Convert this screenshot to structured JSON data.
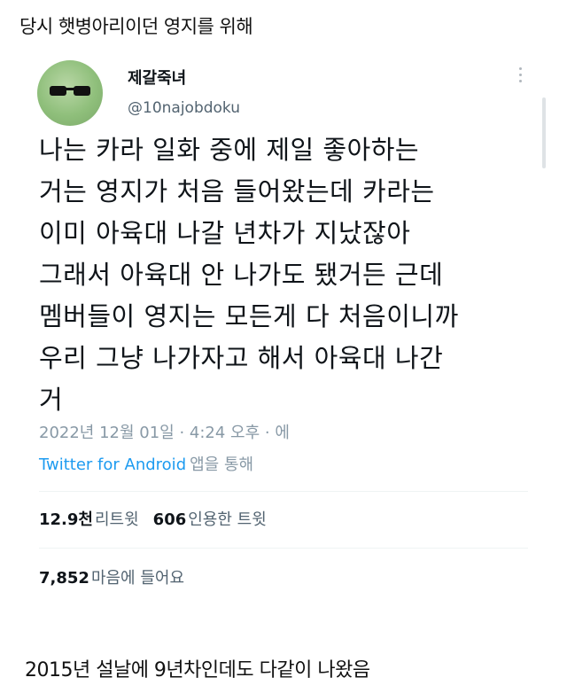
{
  "caption_top": "당시 햇병아리이던 영지를 위해",
  "tweet": {
    "author_name": "제갈죽녀",
    "handle": "@10najobdoku",
    "lines": [
      "나는 카라 일화 중에 제일 좋아하는",
      "거는 영지가 처음 들어왔는데 카라는",
      "이미 아육대 나갈 년차가 지났잖아",
      "그래서 아육대 안 나가도 됐거든 근데",
      "멤버들이 영지는 모든게 다 처음이니까",
      "우리 그냥 나가자고 해서 아육대 나간",
      "거"
    ],
    "timestamp": "2022년 12월 01일 · 4:24 오후 · 에",
    "source_app": "Twitter for Android",
    "source_suffix": "앱을 통해",
    "retweets_count": "12.9천",
    "retweets_label": "리트윗",
    "quotes_count": "606",
    "quotes_label": "인용한 트윗",
    "likes_count": "7,852",
    "likes_label": "마음에 들어요"
  },
  "caption_bottom": "2015년 설날에 9년차인데도 다같이 나왔음",
  "icons": {
    "avatar": "avatar-image",
    "more": "more-options-icon"
  }
}
